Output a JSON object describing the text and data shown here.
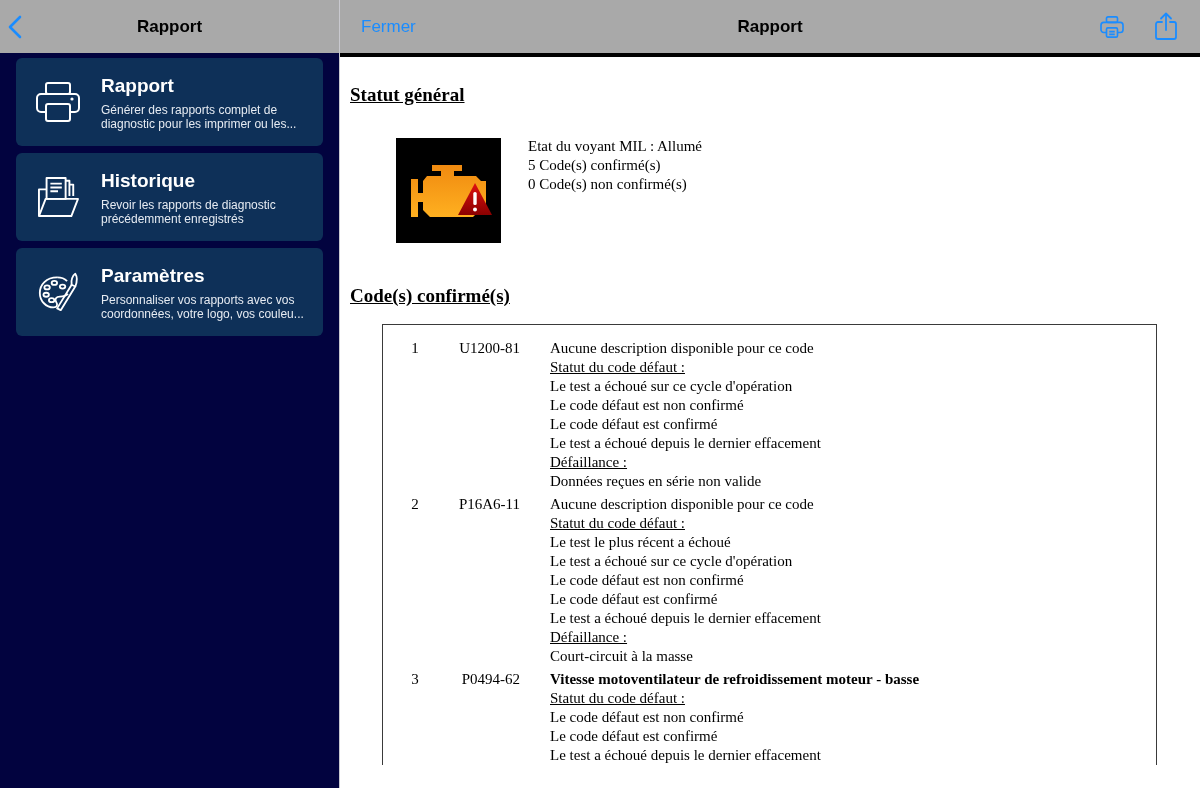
{
  "sidebar": {
    "title": "Rapport",
    "items": [
      {
        "title": "Rapport",
        "description": "Générer des rapports complet de diagnostic pour les imprimer ou les..."
      },
      {
        "title": "Historique",
        "description": "Revoir les rapports de diagnostic précédemment enregistrés"
      },
      {
        "title": "Paramètres",
        "description": "Personnaliser vos rapports avec vos coordonnées, votre logo, vos couleu..."
      }
    ]
  },
  "report": {
    "close_label": "Fermer",
    "title": "Rapport",
    "general_status": {
      "heading": "Statut général",
      "lines": [
        "Etat du voyant MIL : Allumé",
        "5 Code(s) confirmé(s)",
        "0 Code(s) non confirmé(s)"
      ]
    },
    "confirmed_codes": {
      "heading": "Code(s) confirmé(s)",
      "rows": [
        {
          "number": "1",
          "code": "U1200-81",
          "description": "Aucune description disponible pour ce code",
          "emphasized": false,
          "status_heading": "Statut du code défaut :",
          "status": [
            "Le test a échoué sur ce cycle d'opération",
            "Le code défaut est non confirmé",
            "Le code défaut est confirmé",
            "Le test a échoué depuis le dernier effacement"
          ],
          "failure_heading": "Défaillance :",
          "failure": "Données reçues en série non valide"
        },
        {
          "number": "2",
          "code": "P16A6-11",
          "description": "Aucune description disponible pour ce code",
          "emphasized": false,
          "status_heading": "Statut du code défaut :",
          "status": [
            "Le test le plus récent a échoué",
            "Le test a échoué sur ce cycle d'opération",
            "Le code défaut est non confirmé",
            "Le code défaut est confirmé",
            "Le test a échoué depuis le dernier effacement"
          ],
          "failure_heading": "Défaillance :",
          "failure": "Court-circuit à la masse"
        },
        {
          "number": "3",
          "code": "P0494-62",
          "description": "Vitesse motoventilateur de refroidissement moteur - basse",
          "emphasized": true,
          "status_heading": "Statut du code défaut :",
          "status": [
            "Le code défaut est non confirmé",
            "Le code défaut est confirmé",
            "Le test a échoué depuis le dernier effacement"
          ]
        }
      ]
    }
  }
}
